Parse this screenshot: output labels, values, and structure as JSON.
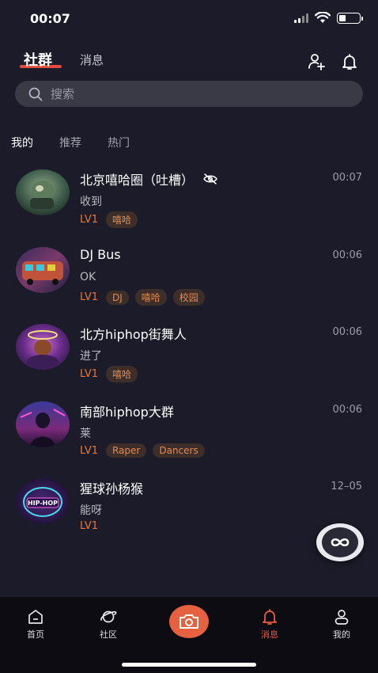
{
  "status_bar": {
    "time": "00:07",
    "battery_level": 0.35
  },
  "header": {
    "tabs": [
      {
        "label": "社群",
        "active": true
      },
      {
        "label": "消息",
        "active": false
      }
    ],
    "icons": [
      "add-friend-icon",
      "bell-icon"
    ],
    "accent_color": "#e64a3b"
  },
  "search": {
    "placeholder": "搜索"
  },
  "sub_tabs": [
    {
      "label": "我的",
      "active": true
    },
    {
      "label": "推荐",
      "active": false
    },
    {
      "label": "热门",
      "active": false
    }
  ],
  "groups": [
    {
      "name": "北京嘻哈圈（吐槽）",
      "muted": true,
      "time": "00:07",
      "message": "收到",
      "level": "LV1",
      "tags": [
        "嘻哈"
      ]
    },
    {
      "name": "DJ Bus",
      "muted": false,
      "time": "00:06",
      "message": "OK",
      "level": "LV1",
      "tags": [
        "DJ",
        "嘻哈",
        "校园"
      ]
    },
    {
      "name": "北方hiphop街舞人",
      "muted": false,
      "time": "00:06",
      "message": "进了",
      "level": "LV1",
      "tags": [
        "嘻哈"
      ]
    },
    {
      "name": "南部hiphop大群",
      "muted": false,
      "time": "00:06",
      "message": "莱",
      "level": "LV1",
      "tags": [
        "Raper",
        "Dancers"
      ]
    },
    {
      "name": "猩球孙杨猴",
      "muted": false,
      "time": "12–05",
      "message": "能呀",
      "level": "LV1",
      "tags": [],
      "avatar_text": [
        "HIP-HOP"
      ]
    }
  ],
  "bottom_nav": [
    {
      "label": "首页",
      "icon": "home-icon",
      "active": false
    },
    {
      "label": "社区",
      "icon": "planet-icon",
      "active": false
    },
    {
      "label": "",
      "icon": "camera-icon",
      "active": false
    },
    {
      "label": "消息",
      "icon": "bell-icon",
      "active": true
    },
    {
      "label": "我的",
      "icon": "profile-icon",
      "active": false
    }
  ],
  "floating_button": {
    "icon": "infinity-icon"
  }
}
